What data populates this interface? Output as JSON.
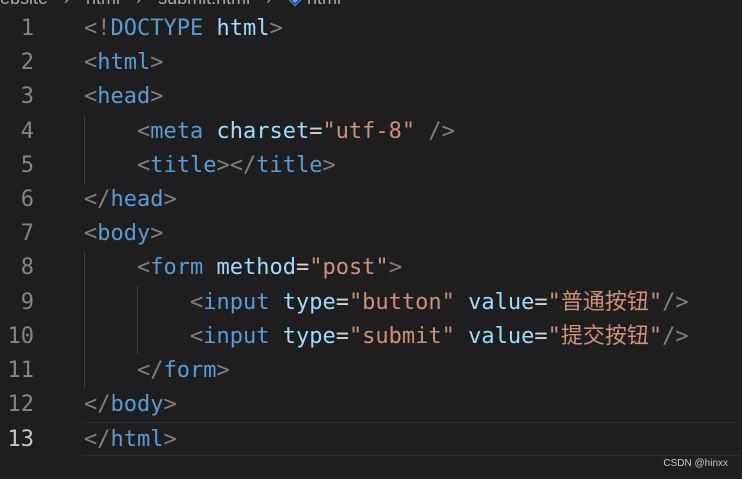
{
  "breadcrumb": {
    "items": [
      "ebsite",
      "html",
      "submit.html",
      "html"
    ],
    "icon": "html-element-icon"
  },
  "lines": [
    {
      "num": "1",
      "tokens": [
        [
          "punct",
          "<!"
        ],
        [
          "doctype",
          "DOCTYPE"
        ],
        [
          "plain",
          " "
        ],
        [
          "attr",
          "html"
        ],
        [
          "punct",
          ">"
        ]
      ]
    },
    {
      "num": "2",
      "tokens": [
        [
          "punct",
          "<"
        ],
        [
          "tag",
          "html"
        ],
        [
          "punct",
          ">"
        ]
      ]
    },
    {
      "num": "3",
      "tokens": [
        [
          "punct",
          "<"
        ],
        [
          "tag",
          "head"
        ],
        [
          "punct",
          ">"
        ]
      ]
    },
    {
      "num": "4",
      "tokens": [
        [
          "plain",
          "    "
        ],
        [
          "punct",
          "<"
        ],
        [
          "tag",
          "meta"
        ],
        [
          "plain",
          " "
        ],
        [
          "attr",
          "charset"
        ],
        [
          "eq",
          "="
        ],
        [
          "str",
          "\"utf-8\""
        ],
        [
          "plain",
          " "
        ],
        [
          "punct",
          "/>"
        ]
      ]
    },
    {
      "num": "5",
      "tokens": [
        [
          "plain",
          "    "
        ],
        [
          "punct",
          "<"
        ],
        [
          "tag",
          "title"
        ],
        [
          "punct",
          "></"
        ],
        [
          "tag",
          "title"
        ],
        [
          "punct",
          ">"
        ]
      ]
    },
    {
      "num": "6",
      "tokens": [
        [
          "punct",
          "</"
        ],
        [
          "tag",
          "head"
        ],
        [
          "punct",
          ">"
        ]
      ]
    },
    {
      "num": "7",
      "tokens": [
        [
          "punct",
          "<"
        ],
        [
          "tag",
          "body"
        ],
        [
          "punct",
          ">"
        ]
      ]
    },
    {
      "num": "8",
      "tokens": [
        [
          "plain",
          "    "
        ],
        [
          "punct",
          "<"
        ],
        [
          "tag",
          "form"
        ],
        [
          "plain",
          " "
        ],
        [
          "attr",
          "method"
        ],
        [
          "eq",
          "="
        ],
        [
          "str",
          "\"post\""
        ],
        [
          "punct",
          ">"
        ]
      ]
    },
    {
      "num": "9",
      "tokens": [
        [
          "plain",
          "        "
        ],
        [
          "punct",
          "<"
        ],
        [
          "tag",
          "input"
        ],
        [
          "plain",
          " "
        ],
        [
          "attr",
          "type"
        ],
        [
          "eq",
          "="
        ],
        [
          "str",
          "\"button\""
        ],
        [
          "plain",
          " "
        ],
        [
          "attr",
          "value"
        ],
        [
          "eq",
          "="
        ],
        [
          "str",
          "\"普通按钮\""
        ],
        [
          "punct",
          "/>"
        ]
      ]
    },
    {
      "num": "10",
      "tokens": [
        [
          "plain",
          "        "
        ],
        [
          "punct",
          "<"
        ],
        [
          "tag",
          "input"
        ],
        [
          "plain",
          " "
        ],
        [
          "attr",
          "type"
        ],
        [
          "eq",
          "="
        ],
        [
          "str",
          "\"submit\""
        ],
        [
          "plain",
          " "
        ],
        [
          "attr",
          "value"
        ],
        [
          "eq",
          "="
        ],
        [
          "str",
          "\"提交按钮\""
        ],
        [
          "punct",
          "/>"
        ]
      ]
    },
    {
      "num": "11",
      "tokens": [
        [
          "plain",
          "    "
        ],
        [
          "punct",
          "</"
        ],
        [
          "tag",
          "form"
        ],
        [
          "punct",
          ">"
        ]
      ]
    },
    {
      "num": "12",
      "tokens": [
        [
          "punct",
          "</"
        ],
        [
          "tag",
          "body"
        ],
        [
          "punct",
          ">"
        ]
      ]
    },
    {
      "num": "13",
      "tokens": [
        [
          "punct",
          "</"
        ],
        [
          "tag",
          "html"
        ],
        [
          "punct",
          ">"
        ]
      ]
    }
  ],
  "active_line": "13",
  "watermark": "CSDN @hinxx",
  "colors": {
    "background": "#1e1e1e",
    "tag": "#569cd6",
    "attribute": "#9cdcfe",
    "string": "#ce9178",
    "punctuation": "#808080",
    "line_number": "#858585"
  }
}
